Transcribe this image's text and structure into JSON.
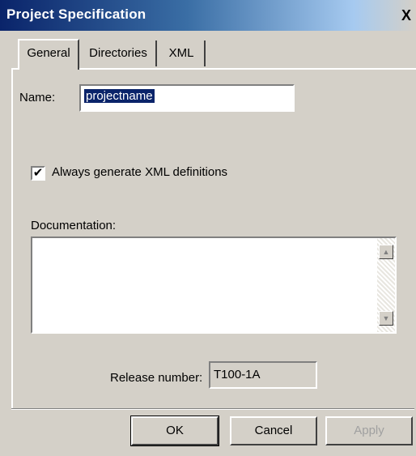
{
  "window": {
    "title": "Project Specification",
    "close_glyph": "X"
  },
  "tabs": [
    {
      "label": "General",
      "active": true
    },
    {
      "label": "Directories",
      "active": false
    },
    {
      "label": "XML",
      "active": false
    }
  ],
  "general": {
    "name_label": "Name:",
    "name_value": "projectname",
    "checkbox_checked": true,
    "checkbox_glyph": "✔",
    "checkbox_label": "Always generate XML definitions",
    "documentation_label": "Documentation:",
    "documentation_value": "",
    "scroll_up_glyph": "▲",
    "scroll_down_glyph": "▼",
    "release_label": "Release number:",
    "release_value": "T100-1A"
  },
  "buttons": {
    "ok": "OK",
    "cancel": "Cancel",
    "apply": "Apply"
  },
  "colors": {
    "title_bar": "#0a246a",
    "dialog_bg": "#d4d0c8",
    "selection": "#0a246a",
    "disabled_text": "#a0a0a0"
  }
}
